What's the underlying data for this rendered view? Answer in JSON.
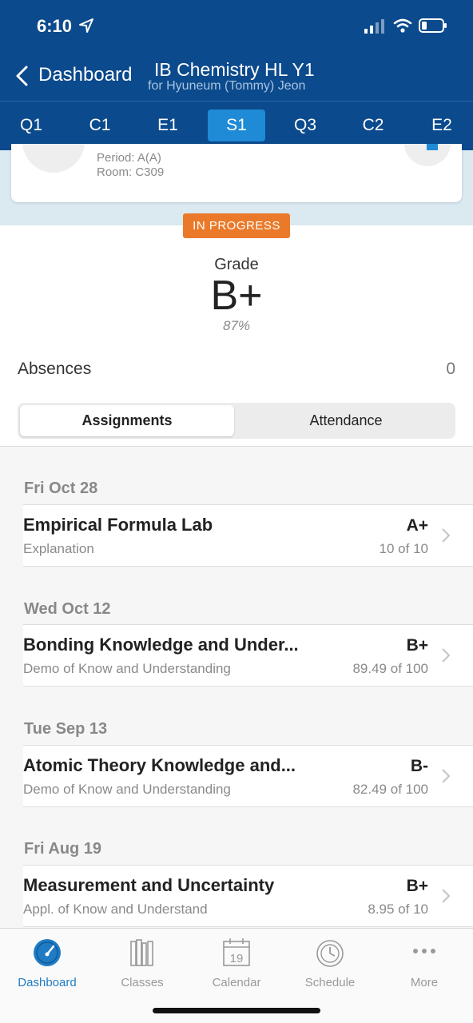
{
  "status_bar": {
    "time": "6:10"
  },
  "nav": {
    "back_label": "Dashboard",
    "title": "IB Chemistry HL Y1",
    "subtitle": "for Hyuneum (Tommy) Jeon"
  },
  "terms": [
    "Q1",
    "C1",
    "E1",
    "S1",
    "Q3",
    "C2",
    "E2"
  ],
  "active_term": "S1",
  "class_card": {
    "period": "Period: A(A)",
    "room": "Room: C309"
  },
  "status_badge": "IN PROGRESS",
  "grade": {
    "label": "Grade",
    "letter": "B+",
    "percent": "87%"
  },
  "absences": {
    "label": "Absences",
    "value": "0"
  },
  "segments": {
    "assignments": "Assignments",
    "attendance": "Attendance"
  },
  "assignments": [
    {
      "date": "Fri Oct 28",
      "title": "Empirical Formula Lab",
      "category": "Explanation",
      "grade": "A+",
      "score": "10 of 10"
    },
    {
      "date": "Wed Oct 12",
      "title": "Bonding Knowledge and Under...",
      "category": "Demo of Know and Understanding",
      "grade": "B+",
      "score": "89.49 of 100"
    },
    {
      "date": "Tue Sep 13",
      "title": "Atomic Theory Knowledge and...",
      "category": "Demo of Know and Understanding",
      "grade": "B-",
      "score": "82.49 of 100"
    },
    {
      "date": "Fri Aug 19",
      "title": "Measurement and Uncertainty",
      "category": "Appl. of Know and Understand",
      "grade": "B+",
      "score": "8.95 of 10"
    }
  ],
  "tabs": [
    {
      "label": "Dashboard",
      "icon": "dashboard-gauge-icon"
    },
    {
      "label": "Classes",
      "icon": "books-icon"
    },
    {
      "label": "Calendar",
      "icon": "calendar-icon",
      "day": "19"
    },
    {
      "label": "Schedule",
      "icon": "clock-icon"
    },
    {
      "label": "More",
      "icon": "more-dots-icon"
    }
  ],
  "colors": {
    "header": "#0b4a8c",
    "active_term": "#1f8ad6",
    "badge": "#ea7a2a",
    "active_tab": "#1f7bc4"
  }
}
